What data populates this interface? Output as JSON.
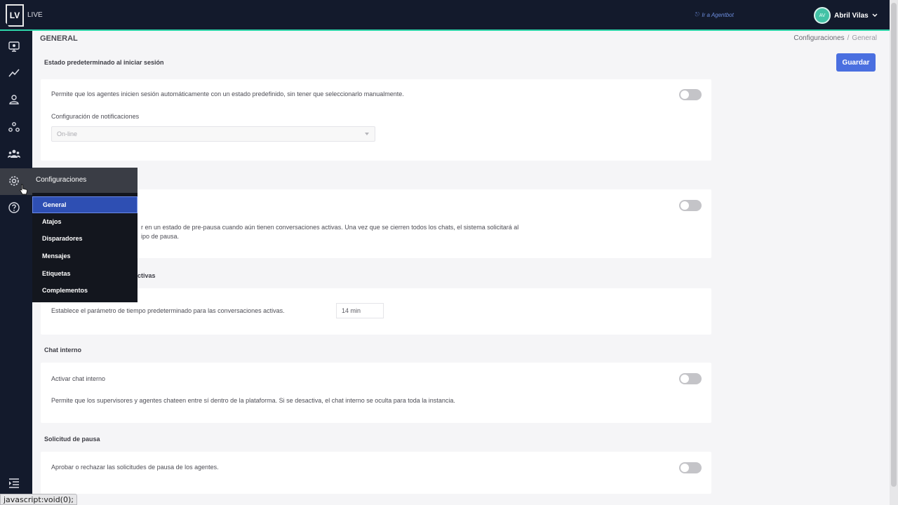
{
  "topbar": {
    "logo": "LV",
    "product": "LIVE",
    "agentbot_link": "Ir a Agentbot",
    "user_initials": "AV",
    "user_name": "Abril Vilas"
  },
  "sidebar": {
    "icons": [
      "monitor-icon",
      "chart-line-icon",
      "user-icon",
      "network-icon",
      "team-icon",
      "gear-icon",
      "help-icon",
      "collapse-menu-icon"
    ]
  },
  "flyout": {
    "title": "Configuraciones",
    "items": [
      "General",
      "Atajos",
      "Disparadores",
      "Mensajes",
      "Etiquetas",
      "Complementos"
    ],
    "active": "General"
  },
  "header": {
    "title": "GENERAL",
    "breadcrumb": [
      "Configuraciones",
      "General"
    ],
    "save_label": "Guardar"
  },
  "sections": {
    "default_state": {
      "title": "Estado predeterminado al iniciar sesión",
      "description": "Permite que los agentes inicien sesión automáticamente con un estado predefinido, sin tener que seleccionarlo manualmente.",
      "notif_label": "Configuración de notificaciones",
      "select_value": "On-line",
      "enabled": false
    },
    "prepause": {
      "description_line1": "r en un estado de pre-pausa cuando aún tienen conversaciones activas. Una vez que se cierren todos los chats, el sistema solicitará al",
      "description_line2": "ipo de pausa.",
      "enabled": false
    },
    "active_time": {
      "title_fragment": "ctivas",
      "description": "Establece el parámetro de tiempo predeterminado para las conversaciones activas.",
      "value": "14  min"
    },
    "internal_chat": {
      "title": "Chat interno",
      "label": "Activar chat interno",
      "description": "Permite que los supervisores y agentes chateen entre sí dentro de la plataforma. Si se desactiva, el chat interno se oculta para toda la instancia.",
      "enabled": false
    },
    "pause_request": {
      "title": "Solicitud de pausa",
      "description": "Aprobar o rechazar las solicitudes de pausa de los agentes.",
      "enabled": false
    }
  },
  "status_tip": "javascript:void(0);",
  "colors": {
    "topbar": "#131a2c",
    "accent_line": "#2dd4a8",
    "primary_button": "#4a6fe0",
    "flyout_active": "#2e4fb3"
  }
}
